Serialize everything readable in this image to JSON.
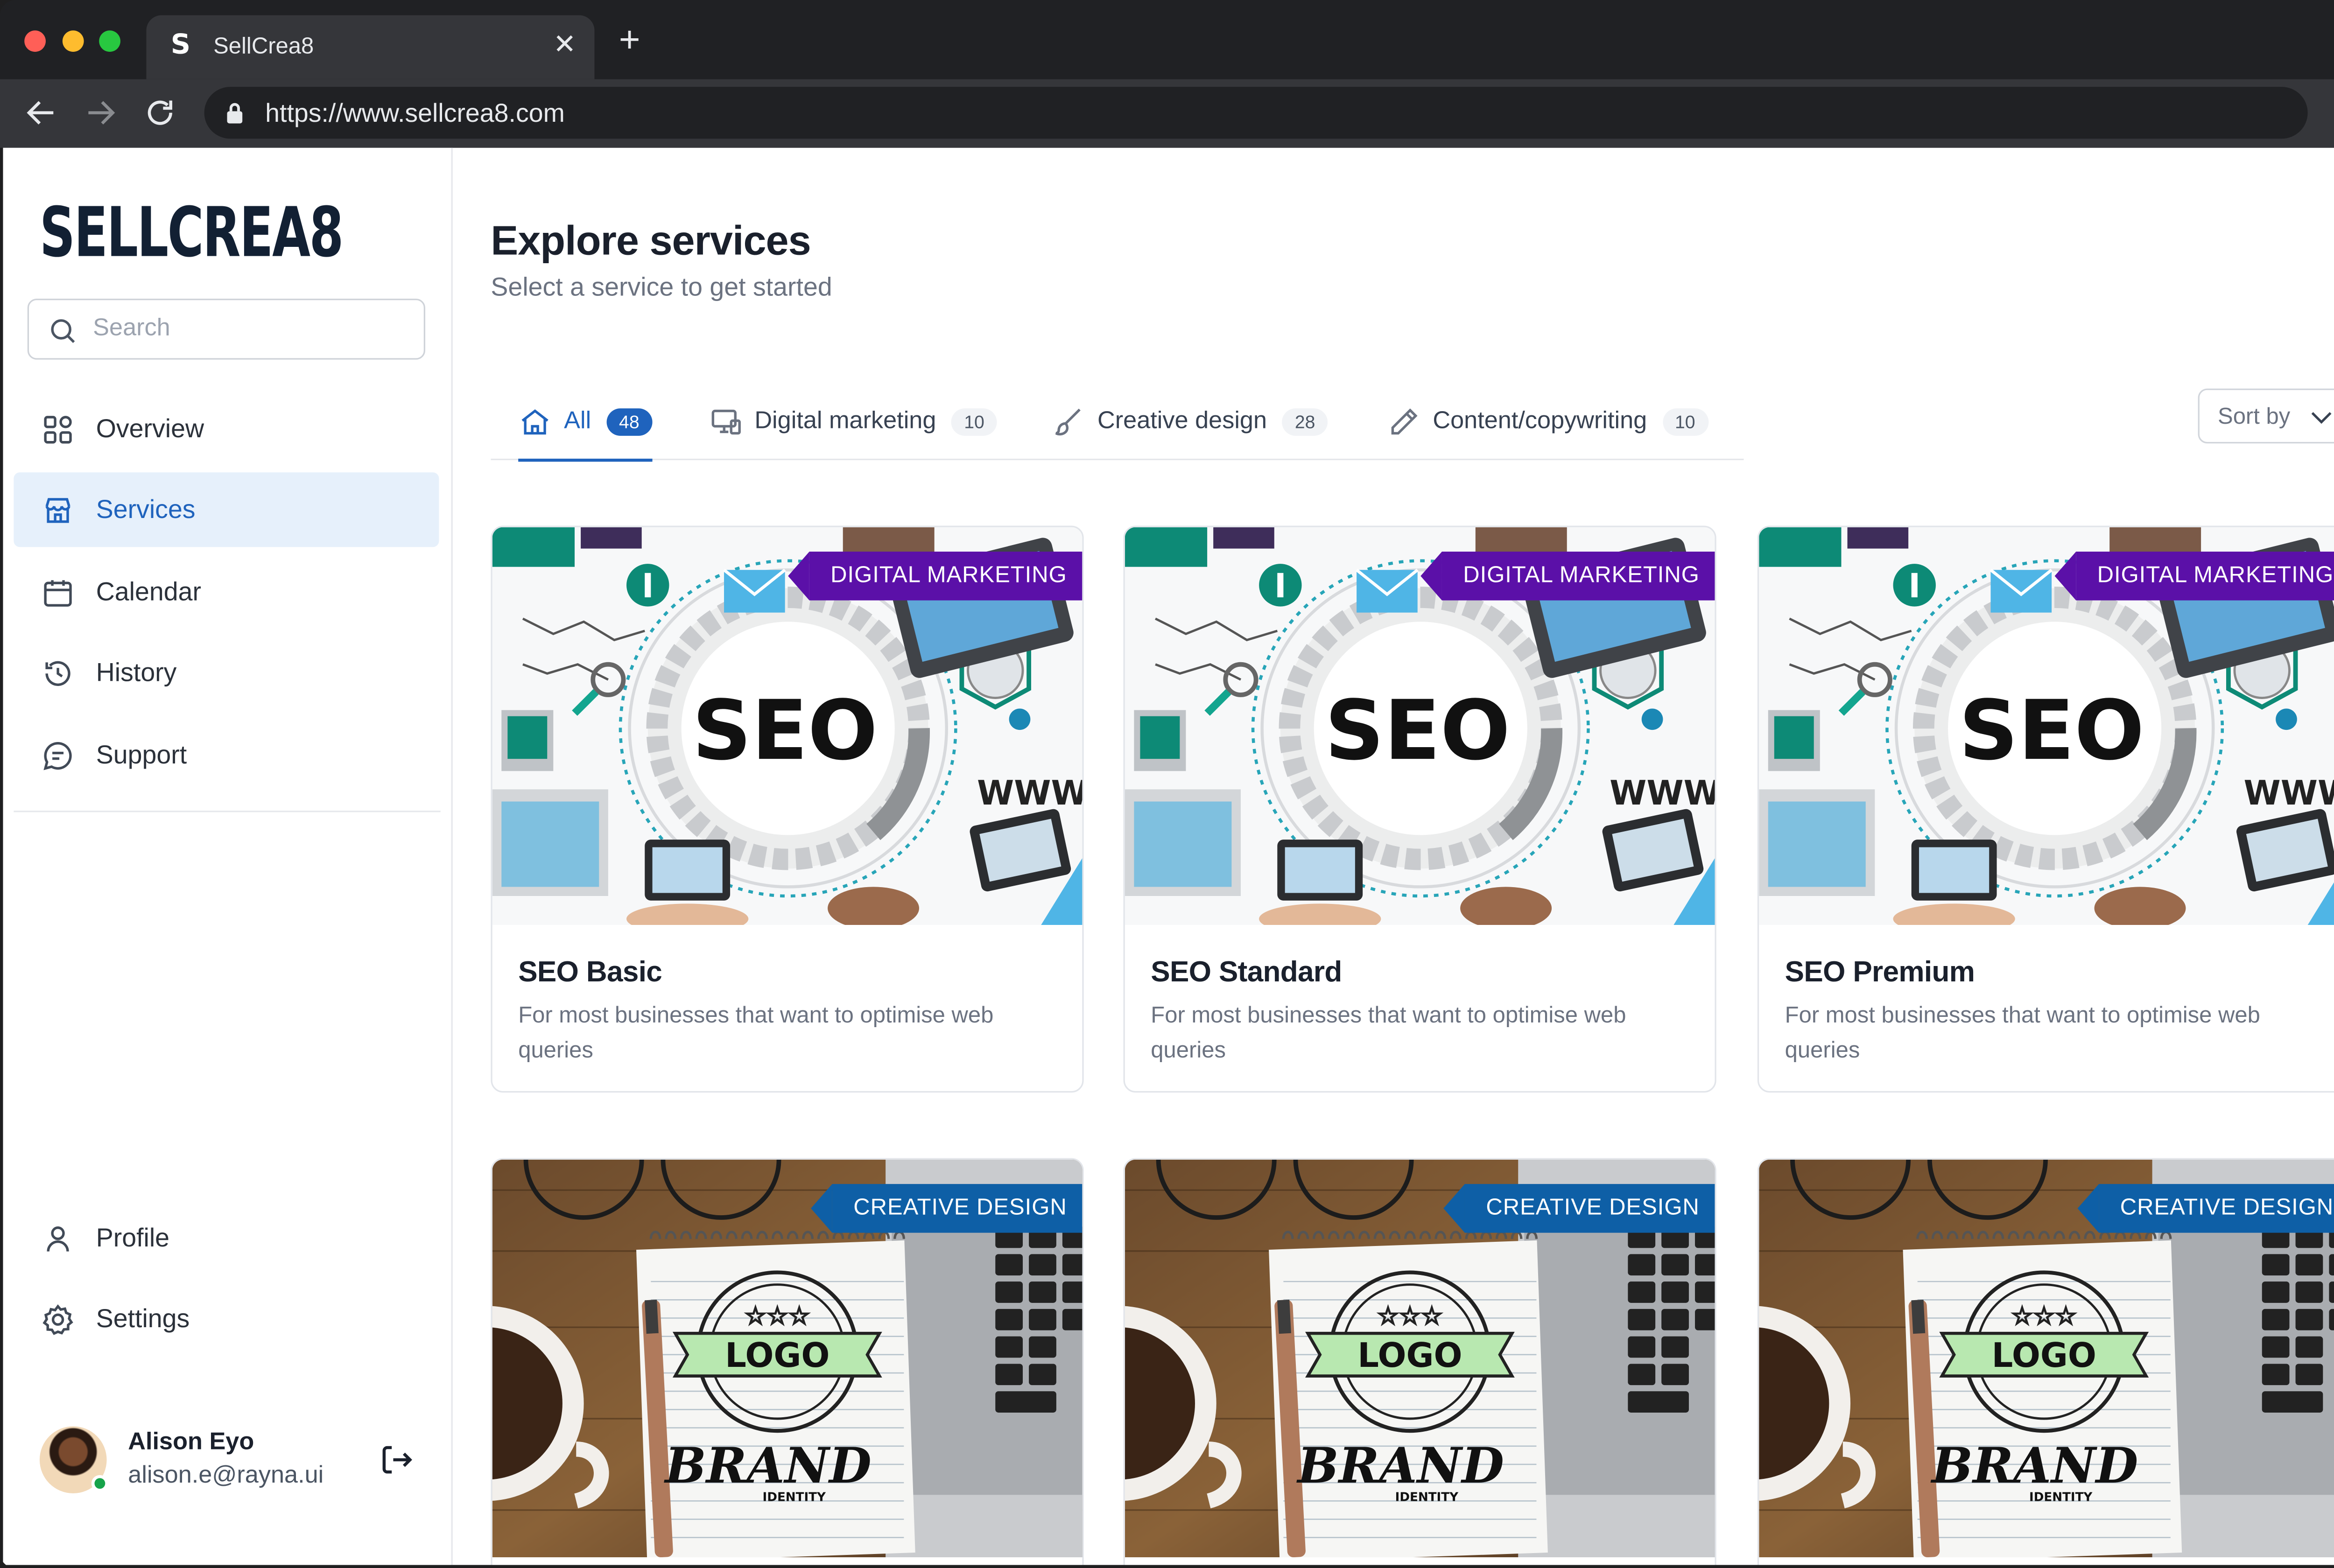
{
  "browser": {
    "tab_title": "SellCrea8",
    "favicon": "S",
    "url": "https://www.sellcrea8.com"
  },
  "sidebar": {
    "logo": "SELLCREA8",
    "search_placeholder": "Search",
    "items": [
      {
        "label": "Overview",
        "icon": "grid-icon"
      },
      {
        "label": "Services",
        "icon": "store-icon",
        "active": true
      },
      {
        "label": "Calendar",
        "icon": "calendar-icon"
      },
      {
        "label": "History",
        "icon": "history-icon"
      },
      {
        "label": "Support",
        "icon": "chat-icon"
      }
    ],
    "bottom_items": [
      {
        "label": "Profile",
        "icon": "user-icon"
      },
      {
        "label": "Settings",
        "icon": "gear-icon"
      }
    ],
    "user": {
      "name": "Alison Eyo",
      "email": "alison.e@rayna.ui",
      "status": "online"
    }
  },
  "main": {
    "title": "Explore services",
    "subtitle": "Select a service to get started",
    "tabs": [
      {
        "label": "All",
        "count": "48",
        "icon": "home-icon",
        "active": true
      },
      {
        "label": "Digital marketing",
        "count": "10",
        "icon": "monitor-icon"
      },
      {
        "label": "Creative design",
        "count": "28",
        "icon": "brush-icon"
      },
      {
        "label": "Content/copywriting",
        "count": "10",
        "icon": "pencil-icon"
      }
    ],
    "sort_label": "Sort by",
    "cards": [
      {
        "title": "SEO Basic",
        "desc": "For most businesses that want to optimise web queries",
        "tag": "DIGITAL MARKETING",
        "image_text": "SEO",
        "image_sub": "WWW"
      },
      {
        "title": "SEO Standard",
        "desc": "For most businesses that want to optimise web queries",
        "tag": "DIGITAL MARKETING",
        "image_text": "SEO",
        "image_sub": "WWW"
      },
      {
        "title": "SEO Premium",
        "desc": "For most businesses that want to optimise web queries",
        "tag": "DIGITAL MARKETING",
        "image_text": "SEO",
        "image_sub": "WWW"
      },
      {
        "title": "",
        "desc": "",
        "tag": "CREATIVE DESIGN",
        "image_text": "LOGO",
        "image_sub": "BRAND",
        "image_sub2": "IDENTITY"
      },
      {
        "title": "",
        "desc": "",
        "tag": "CREATIVE DESIGN",
        "image_text": "LOGO",
        "image_sub": "BRAND",
        "image_sub2": "IDENTITY"
      },
      {
        "title": "",
        "desc": "",
        "tag": "CREATIVE DESIGN",
        "image_text": "LOGO",
        "image_sub": "BRAND",
        "image_sub2": "IDENTITY"
      }
    ]
  },
  "colors": {
    "accent": "#1f63bd",
    "digital_marketing_tag": "#5b10a8",
    "creative_design_tag": "#0e5fa6",
    "active_nav_bg": "#e6f0fb"
  }
}
